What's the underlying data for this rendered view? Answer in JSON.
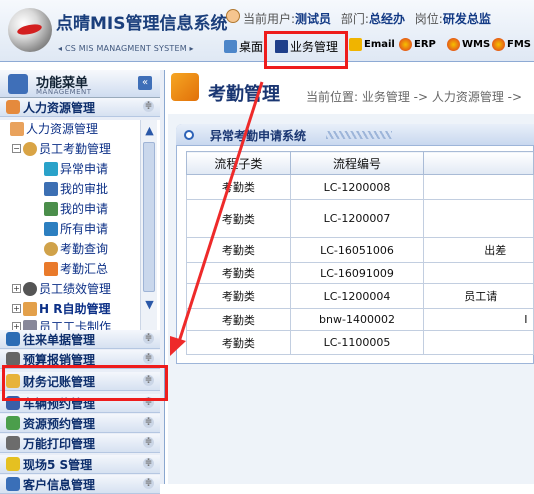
{
  "header": {
    "app_title": "点晴MIS管理信息系统",
    "app_subtitle": "◂ CS MIS MANAGMENT SYSTEM ▸",
    "user_label": "当前用户:",
    "user_value": "测试员",
    "dept_label": "部门:",
    "dept_value": "总经办",
    "post_label": "岗位:",
    "post_value": "研发总监",
    "nav": [
      "桌面",
      "业务管理",
      "Email",
      "ERP",
      "WMS",
      "FMS"
    ]
  },
  "sidebar": {
    "title": "功能菜单",
    "subtitle": "MANAGEMENT",
    "collapse_glyph": "«",
    "top_group": "人力资源管理",
    "tree": [
      "人力资源管理",
      "员工考勤管理",
      "异常申请",
      "我的审批",
      "我的申请",
      "所有申请",
      "考勤查询",
      "考勤汇总",
      "员工绩效管理",
      "H R自助管理",
      "员工工卡制作"
    ],
    "groups": [
      "往来单据管理",
      "预算报销管理",
      "财务记账管理",
      "车辆预约管理",
      "资源预约管理",
      "万能打印管理",
      "现场5 S管理",
      "客户信息管理"
    ]
  },
  "main": {
    "title": "考勤管理",
    "location": "当前位置: 业务管理 -> 人力资源管理 ->",
    "panel_title": "异常考勤申请系统",
    "columns": [
      "流程子类",
      "流程编号",
      ""
    ],
    "rows": [
      [
        "考勤类",
        "LC-1200008",
        ""
      ],
      [
        "考勤类",
        "LC-1200007",
        ""
      ],
      [
        "考勤类",
        "LC-16051006",
        "出差"
      ],
      [
        "考勤类",
        "LC-16091009",
        ""
      ],
      [
        "考勤类",
        "LC-1200004",
        "员工请"
      ],
      [
        "考勤类",
        "bnw-1400002",
        "I"
      ],
      [
        "考勤类",
        "LC-1100005",
        ""
      ]
    ]
  },
  "colors": {
    "highlight": "#ee1c1c",
    "brand": "#1b3f7c"
  }
}
